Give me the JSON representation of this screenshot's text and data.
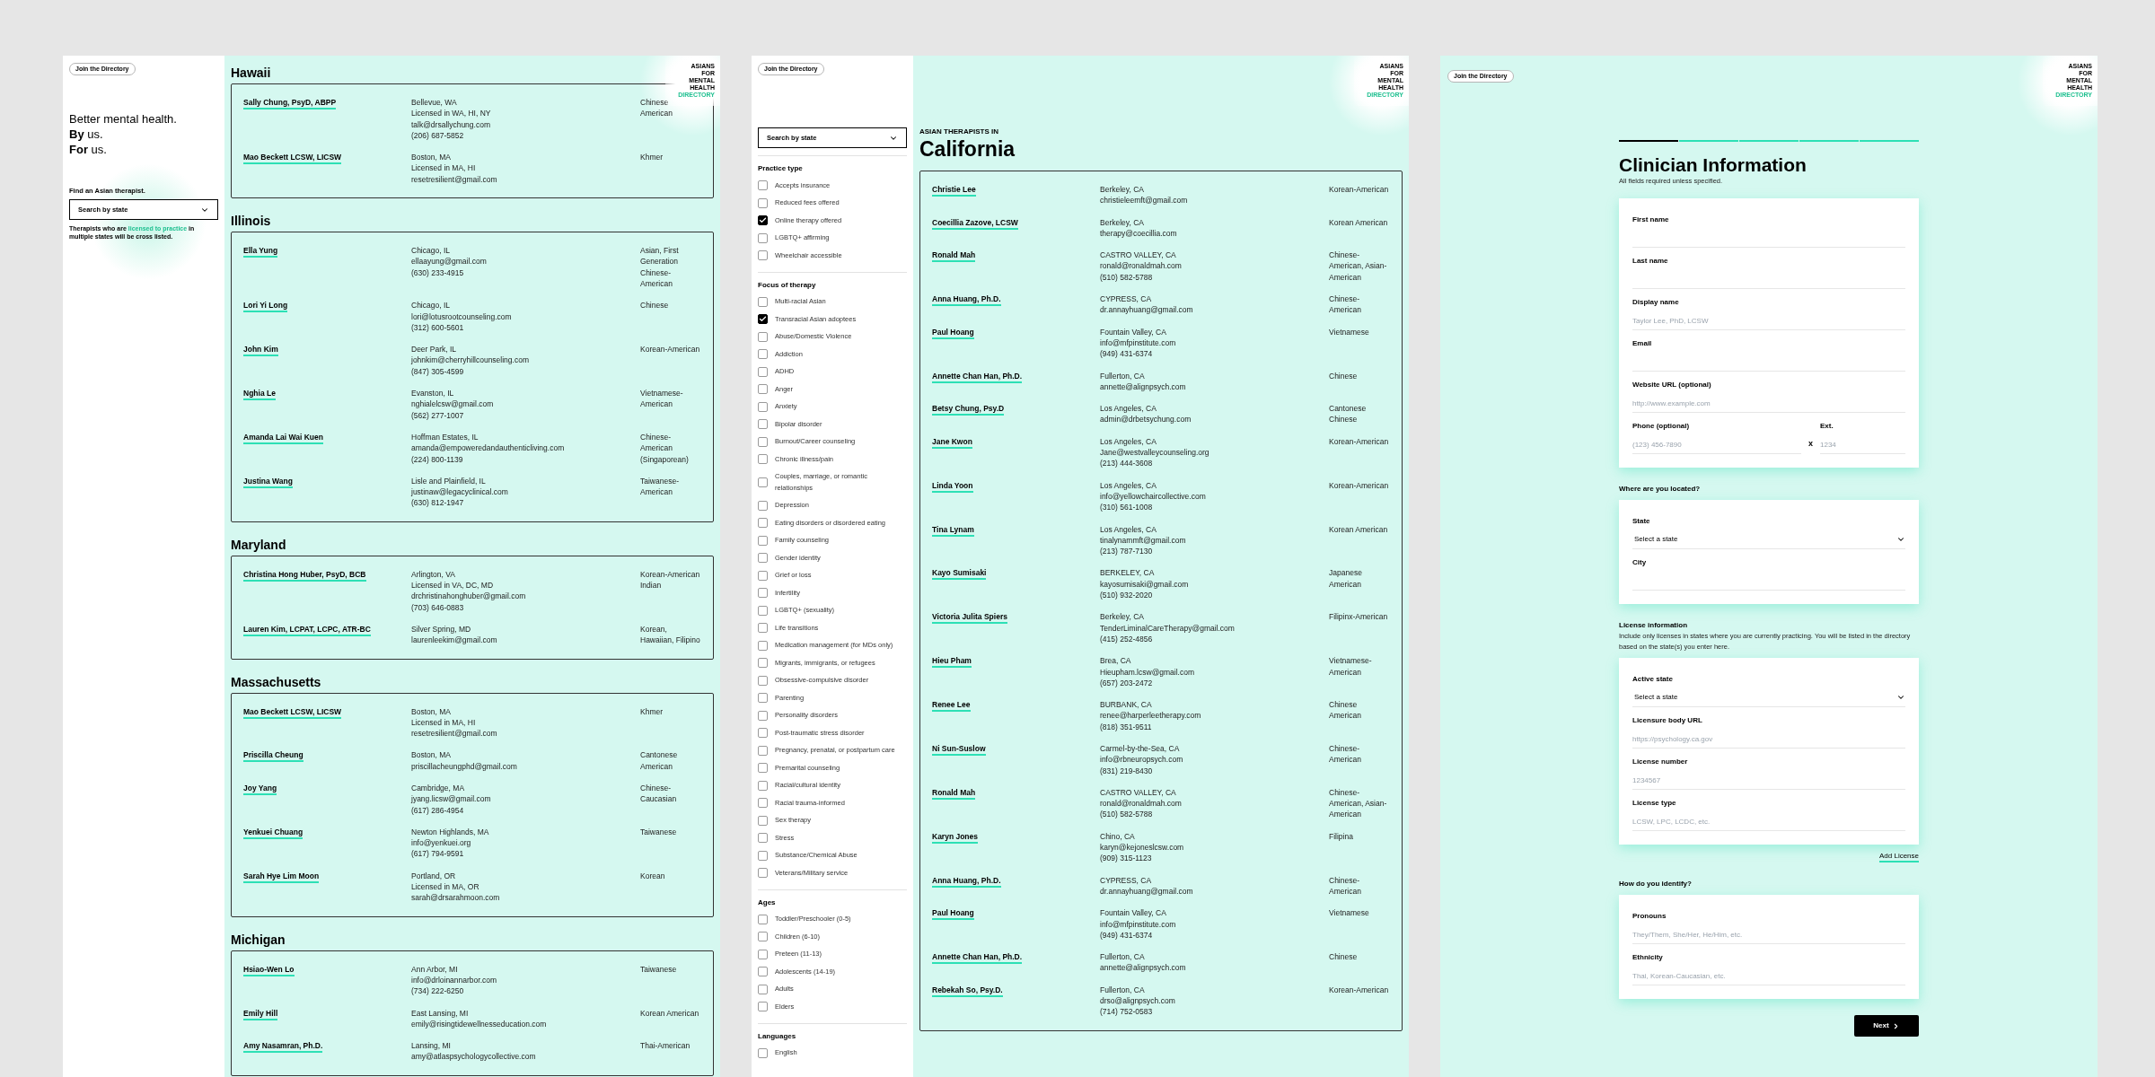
{
  "panels": [
    {
      "kind": "directory",
      "join_button": "Join the Directory",
      "logo": {
        "lines": [
          "ASIANS",
          "FOR",
          "MENTAL",
          "HEALTH"
        ],
        "accent": "DIRECTORY"
      },
      "sidebar": {
        "tagline": [
          "Better mental health.",
          "**By** us.",
          "**For** us."
        ],
        "search_label": "Find an Asian therapist.",
        "search_select": "Search by state",
        "note": {
          "before": "Therapists who are",
          "link": "licensed to practice",
          "after": "in multiple states will be cross listed."
        }
      },
      "sections": [
        {
          "state": "Hawaii",
          "therapists": [
            {
              "name": "Sally Chung, PsyD, ABPP",
              "details": [
                "Bellevue, WA",
                "Licensed in WA, HI, NY",
                "talk@drsallychung.com",
                "(206) 687-5852"
              ],
              "ethnicity": "Chinese American"
            },
            {
              "name": "Mao Beckett LCSW, LICSW",
              "details": [
                "Boston, MA",
                "Licensed in MA, HI",
                "resetresilient@gmail.com"
              ],
              "ethnicity": "Khmer"
            }
          ]
        },
        {
          "state": "Illinois",
          "therapists": [
            {
              "name": "Ella Yung",
              "details": [
                "Chicago, IL",
                "ellaayung@gmail.com",
                "(630) 233-4915"
              ],
              "ethnicity": "Asian, First Generation Chinese-American"
            },
            {
              "name": "Lori Yi Long",
              "details": [
                "Chicago, IL",
                "lori@lotusrootcounseling.com",
                "(312) 600-5601"
              ],
              "ethnicity": "Chinese"
            },
            {
              "name": "John Kim",
              "details": [
                "Deer Park, IL",
                "johnkim@cherryhillcounseling.com",
                "(847) 305-4599"
              ],
              "ethnicity": "Korean-American"
            },
            {
              "name": "Nghia Le",
              "details": [
                "Evanston, IL",
                "nghialelcsw@gmail.com",
                "(562) 277-1007"
              ],
              "ethnicity": "Vietnamese-American"
            },
            {
              "name": "Amanda Lai Wai Kuen",
              "details": [
                "Hoffman Estates, IL",
                "amanda@empoweredandauthenticliving.com",
                "(224) 800-1139"
              ],
              "ethnicity": "Chinese-American (Singaporean)"
            },
            {
              "name": "Justina Wang",
              "details": [
                "Lisle and Plainfield, IL",
                "justinaw@legacyclinical.com",
                "(630) 812-1947"
              ],
              "ethnicity": "Taiwanese-American"
            }
          ]
        },
        {
          "state": "Maryland",
          "therapists": [
            {
              "name": "Christina Hong Huber, PsyD, BCB",
              "details": [
                "Arlington, VA",
                "Licensed in VA, DC, MD",
                "drchristinahonghuber@gmail.com",
                "(703) 646-0883"
              ],
              "ethnicity": "Korean-American Indian"
            },
            {
              "name": "Lauren Kim, LCPAT, LCPC, ATR-BC",
              "details": [
                "Silver Spring, MD",
                "laurenleekim@gmail.com"
              ],
              "ethnicity": "Korean, Hawaiian, Filipino"
            }
          ]
        },
        {
          "state": "Massachusetts",
          "therapists": [
            {
              "name": "Mao Beckett LCSW, LICSW",
              "details": [
                "Boston, MA",
                "Licensed in MA, HI",
                "resetresilient@gmail.com"
              ],
              "ethnicity": "Khmer"
            },
            {
              "name": "Priscilla Cheung",
              "details": [
                "Boston, MA",
                "priscillacheungphd@gmail.com"
              ],
              "ethnicity": "Cantonese American"
            },
            {
              "name": "Joy Yang",
              "details": [
                "Cambridge, MA",
                "jyang.licsw@gmail.com",
                "(617) 286-4954"
              ],
              "ethnicity": "Chinese-Caucasian"
            },
            {
              "name": "Yenkuei Chuang",
              "details": [
                "Newton Highlands, MA",
                "info@yenkuei.org",
                "(617) 794-9591"
              ],
              "ethnicity": "Taiwanese"
            },
            {
              "name": "Sarah Hye Lim Moon",
              "details": [
                "Portland, OR",
                "Licensed in MA, OR",
                "sarah@drsarahmoon.com"
              ],
              "ethnicity": "Korean"
            }
          ]
        },
        {
          "state": "Michigan",
          "therapists": [
            {
              "name": "Hsiao-Wen Lo",
              "details": [
                "Ann Arbor, MI",
                "info@drloinannarbor.com",
                "(734) 222-6250"
              ],
              "ethnicity": "Taiwanese"
            },
            {
              "name": "Emily Hill",
              "details": [
                "East Lansing, MI",
                "emily@risingtidewellnesseducation.com"
              ],
              "ethnicity": "Korean American"
            },
            {
              "name": "Amy Nasamran, Ph.D.",
              "details": [
                "Lansing, MI",
                "amy@atlaspsychologycollective.com"
              ],
              "ethnicity": "Thai-American"
            }
          ]
        }
      ]
    },
    {
      "kind": "state",
      "join_button": "Join the Directory",
      "logo": {
        "lines": [
          "ASIANS",
          "FOR",
          "MENTAL",
          "HEALTH"
        ],
        "accent": "DIRECTORY"
      },
      "filters": {
        "search_select": "Search by state",
        "groups": [
          {
            "title": "Practice type",
            "options": [
              {
                "label": "Accepts insurance",
                "checked": false
              },
              {
                "label": "Reduced fees offered",
                "checked": false
              },
              {
                "label": "Online therapy offered",
                "checked": true
              },
              {
                "label": "LGBTQ+ affirming",
                "checked": false
              },
              {
                "label": "Wheelchair accessible",
                "checked": false
              }
            ]
          },
          {
            "title": "Focus of therapy",
            "options": [
              {
                "label": "Multi-racial Asian",
                "checked": false
              },
              {
                "label": "Transracial Asian adoptees",
                "checked": true
              },
              {
                "label": "Abuse/Domestic Violence",
                "checked": false
              },
              {
                "label": "Addiction",
                "checked": false
              },
              {
                "label": "ADHD",
                "checked": false
              },
              {
                "label": "Anger",
                "checked": false
              },
              {
                "label": "Anxiety",
                "checked": false
              },
              {
                "label": "Bipolar disorder",
                "checked": false
              },
              {
                "label": "Burnout/Career counseling",
                "checked": false
              },
              {
                "label": "Chronic illness/pain",
                "checked": false
              },
              {
                "label": "Couples, marriage, or romantic relationships",
                "checked": false
              },
              {
                "label": "Depression",
                "checked": false
              },
              {
                "label": "Eating disorders or disordered eating",
                "checked": false
              },
              {
                "label": "Family counseling",
                "checked": false
              },
              {
                "label": "Gender identity",
                "checked": false
              },
              {
                "label": "Grief or loss",
                "checked": false
              },
              {
                "label": "Infertility",
                "checked": false
              },
              {
                "label": "LGBTQ+ (sexuality)",
                "checked": false
              },
              {
                "label": "Life transitions",
                "checked": false
              },
              {
                "label": "Medication management (for MDs only)",
                "checked": false
              },
              {
                "label": "Migrants, immigrants, or refugees",
                "checked": false
              },
              {
                "label": "Obsessive-compulsive disorder",
                "checked": false
              },
              {
                "label": "Parenting",
                "checked": false
              },
              {
                "label": "Personality disorders",
                "checked": false
              },
              {
                "label": "Post-traumatic stress disorder",
                "checked": false
              },
              {
                "label": "Pregnancy, prenatal, or postpartum care",
                "checked": false
              },
              {
                "label": "Premarital counseling",
                "checked": false
              },
              {
                "label": "Racial/cultural identity",
                "checked": false
              },
              {
                "label": "Racial trauma-informed",
                "checked": false
              },
              {
                "label": "Sex therapy",
                "checked": false
              },
              {
                "label": "Stress",
                "checked": false
              },
              {
                "label": "Substance/Chemical Abuse",
                "checked": false
              },
              {
                "label": "Veterans/Military service",
                "checked": false
              }
            ]
          },
          {
            "title": "Ages",
            "options": [
              {
                "label": "Toddler/Preschooler (0-5)",
                "checked": false
              },
              {
                "label": "Children (6-10)",
                "checked": false
              },
              {
                "label": "Preteen (11-13)",
                "checked": false
              },
              {
                "label": "Adolescents (14-19)",
                "checked": false
              },
              {
                "label": "Adults",
                "checked": false
              },
              {
                "label": "Elders",
                "checked": false
              }
            ]
          },
          {
            "title": "Languages",
            "options": [
              {
                "label": "English",
                "checked": false
              }
            ]
          }
        ]
      },
      "eyebrow": "ASIAN THERAPISTS IN",
      "state": "California",
      "therapists": [
        {
          "name": "Christie Lee",
          "details": [
            "Berkeley, CA",
            "christieleemft@gmail.com"
          ],
          "ethnicity": "Korean-American"
        },
        {
          "name": "Coecillia Zazove, LCSW",
          "details": [
            "Berkeley, CA",
            "therapy@coecillia.com"
          ],
          "ethnicity": "Korean American"
        },
        {
          "name": "Ronald Mah",
          "details": [
            "CASTRO VALLEY, CA",
            "ronald@ronaldmah.com",
            "(510) 582-5788"
          ],
          "ethnicity": "Chinese-American, Asian-American"
        },
        {
          "name": "Anna Huang, Ph.D.",
          "details": [
            "CYPRESS, CA",
            "dr.annayhuang@gmail.com"
          ],
          "ethnicity": "Chinese-American"
        },
        {
          "name": "Paul Hoang",
          "details": [
            "Fountain Valley, CA",
            "info@mfpinstitute.com",
            "(949) 431-6374"
          ],
          "ethnicity": "Vietnamese"
        },
        {
          "name": "Annette Chan Han, Ph.D.",
          "details": [
            "Fullerton, CA",
            "annette@alignpsych.com"
          ],
          "ethnicity": "Chinese"
        },
        {
          "name": "Betsy Chung, Psy.D",
          "details": [
            "Los Angeles, CA",
            "admin@drbetsychung.com"
          ],
          "ethnicity": "Cantonese Chinese"
        },
        {
          "name": "Jane Kwon",
          "details": [
            "Los Angeles, CA",
            "Jane@westvalleycounseling.org",
            "(213) 444-3608"
          ],
          "ethnicity": "Korean-American"
        },
        {
          "name": "Linda Yoon",
          "details": [
            "Los Angeles, CA",
            "info@yellowchaircollective.com",
            "(310) 561-1008"
          ],
          "ethnicity": "Korean-American"
        },
        {
          "name": "Tina Lynam",
          "details": [
            "Los Angeles, CA",
            "tinalynammft@gmail.com",
            "(213) 787-7130"
          ],
          "ethnicity": "Korean American"
        },
        {
          "name": "Kayo Sumisaki",
          "details": [
            "BERKELEY, CA",
            "kayosumisaki@gmail.com",
            "(510) 932-2020"
          ],
          "ethnicity": "Japanese American"
        },
        {
          "name": "Victoria Julita Spiers",
          "details": [
            "Berkeley, CA",
            "TenderLiminalCareTherapy@gmail.com",
            "(415) 252-4856"
          ],
          "ethnicity": "Filipinx-American"
        },
        {
          "name": "Hieu Pham",
          "details": [
            "Brea, CA",
            "Hieupham.lcsw@gmail.com",
            "(657) 203-2472"
          ],
          "ethnicity": "Vietnamese-American"
        },
        {
          "name": "Renee Lee",
          "details": [
            "BURBANK, CA",
            "renee@harperleetherapy.com",
            "(818) 351-9511"
          ],
          "ethnicity": "Chinese American"
        },
        {
          "name": "Ni Sun-Suslow",
          "details": [
            "Carmel-by-the-Sea, CA",
            "info@rbneuropsych.com",
            "(831) 219-8430"
          ],
          "ethnicity": "Chinese-American"
        },
        {
          "name": "Ronald Mah",
          "details": [
            "CASTRO VALLEY, CA",
            "ronald@ronaldmah.com",
            "(510) 582-5788"
          ],
          "ethnicity": "Chinese-American, Asian-American"
        },
        {
          "name": "Karyn Jones",
          "details": [
            "Chino, CA",
            "karyn@kejoneslcsw.com",
            "(909) 315-1123"
          ],
          "ethnicity": "Filipina"
        },
        {
          "name": "Anna Huang, Ph.D.",
          "details": [
            "CYPRESS, CA",
            "dr.annayhuang@gmail.com"
          ],
          "ethnicity": "Chinese-American"
        },
        {
          "name": "Paul Hoang",
          "details": [
            "Fountain Valley, CA",
            "info@mfpinstitute.com",
            "(949) 431-6374"
          ],
          "ethnicity": "Vietnamese"
        },
        {
          "name": "Annette Chan Han, Ph.D.",
          "details": [
            "Fullerton, CA",
            "annette@alignpsych.com"
          ],
          "ethnicity": "Chinese"
        },
        {
          "name": "Rebekah So, Psy.D.",
          "details": [
            "Fullerton, CA",
            "drso@alignpsych.com",
            "(714) 752-0583"
          ],
          "ethnicity": "Korean-American"
        }
      ]
    },
    {
      "kind": "form",
      "join_button": "Join the Directory",
      "logo": {
        "lines": [
          "ASIANS",
          "FOR",
          "MENTAL",
          "HEALTH"
        ],
        "accent": "DIRECTORY"
      },
      "steps": [
        {
          "active": true
        },
        {
          "active": false
        },
        {
          "active": false
        },
        {
          "active": false
        },
        {
          "active": false
        }
      ],
      "title": "Clinician Information",
      "subtitle": "All fields required unless specified.",
      "sections": [
        {
          "fields": [
            {
              "kind": "text",
              "label": "First name"
            },
            {
              "kind": "text",
              "label": "Last name"
            },
            {
              "kind": "text",
              "label": "Display name",
              "placeholder": "Taylor Lee, PhD, LCSW"
            },
            {
              "kind": "text",
              "label": "Email"
            },
            {
              "kind": "text",
              "label": "Website URL (optional)",
              "placeholder": "http://www.example.com"
            },
            {
              "kind": "phone",
              "label": "Phone (optional)",
              "placeholder": "(123) 456-7890",
              "separator": "x",
              "ext_label": "Ext.",
              "ext_placeholder": "1234"
            }
          ]
        },
        {
          "title": "Where are you located?",
          "fields": [
            {
              "kind": "select",
              "label": "State",
              "value": "Select a state"
            },
            {
              "kind": "text",
              "label": "City"
            }
          ]
        },
        {
          "title": "License information",
          "description": "Include only licenses in states where you are currently practicing. You will be listed in the directory based on the state(s) you enter here.",
          "fields": [
            {
              "kind": "select",
              "label": "Active state",
              "value": "Select a state"
            },
            {
              "kind": "text",
              "label": "Licensure body URL",
              "placeholder": "https://psychology.ca.gov"
            },
            {
              "kind": "text",
              "label": "License number",
              "placeholder": "1234567"
            },
            {
              "kind": "text",
              "label": "License type",
              "placeholder": "LCSW, LPC, LCDC, etc."
            }
          ],
          "link": "Add License"
        },
        {
          "title": "How do you identify?",
          "fields": [
            {
              "kind": "text",
              "label": "Pronouns",
              "placeholder": "They/Them, She/Her, He/Him, etc."
            },
            {
              "kind": "text",
              "label": "Ethnicity",
              "placeholder": "Thai, Korean-Caucasian, etc."
            }
          ]
        }
      ],
      "next_button": "Next"
    }
  ]
}
